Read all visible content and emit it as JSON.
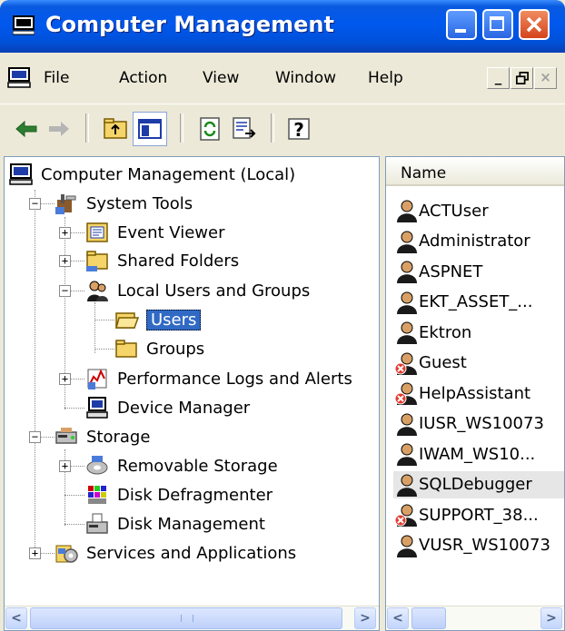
{
  "window": {
    "title": "Computer Management"
  },
  "menubar": {
    "items": [
      {
        "label": "File"
      },
      {
        "label": "Action"
      },
      {
        "label": "View"
      },
      {
        "label": "Window"
      },
      {
        "label": "Help"
      }
    ]
  },
  "toolbar": {
    "icons": [
      "back-arrow-icon",
      "forward-arrow-icon",
      "up-folder-icon",
      "show-hide-tree-icon",
      "refresh-icon",
      "export-list-icon",
      "help-icon"
    ]
  },
  "tree": {
    "root": "Computer Management (Local)",
    "system_tools": "System Tools",
    "event_viewer": "Event Viewer",
    "shared_folders": "Shared Folders",
    "local_users_groups": "Local Users and Groups",
    "users": "Users",
    "groups": "Groups",
    "perf_logs": "Performance Logs and Alerts",
    "device_manager": "Device Manager",
    "storage": "Storage",
    "removable_storage": "Removable Storage",
    "disk_defrag": "Disk Defragmenter",
    "disk_management": "Disk Management",
    "services_apps": "Services and Applications"
  },
  "list": {
    "column_name": "Name",
    "users": [
      {
        "name": "ACTUser",
        "disabled": false
      },
      {
        "name": "Administrator",
        "disabled": false
      },
      {
        "name": "ASPNET",
        "disabled": false
      },
      {
        "name": "EKT_ASSET_...",
        "disabled": false
      },
      {
        "name": "Ektron",
        "disabled": false
      },
      {
        "name": "Guest",
        "disabled": true
      },
      {
        "name": "HelpAssistant",
        "disabled": true
      },
      {
        "name": "IUSR_WS10073",
        "disabled": false
      },
      {
        "name": "IWAM_WS10...",
        "disabled": false
      },
      {
        "name": "SQLDebugger",
        "disabled": false
      },
      {
        "name": "SUPPORT_38...",
        "disabled": true
      },
      {
        "name": "VUSR_WS10073",
        "disabled": false
      }
    ]
  },
  "colors": {
    "titlebar_blue": "#0058EE",
    "selection": "#316AC5",
    "window_bg": "#ECE9D8"
  }
}
